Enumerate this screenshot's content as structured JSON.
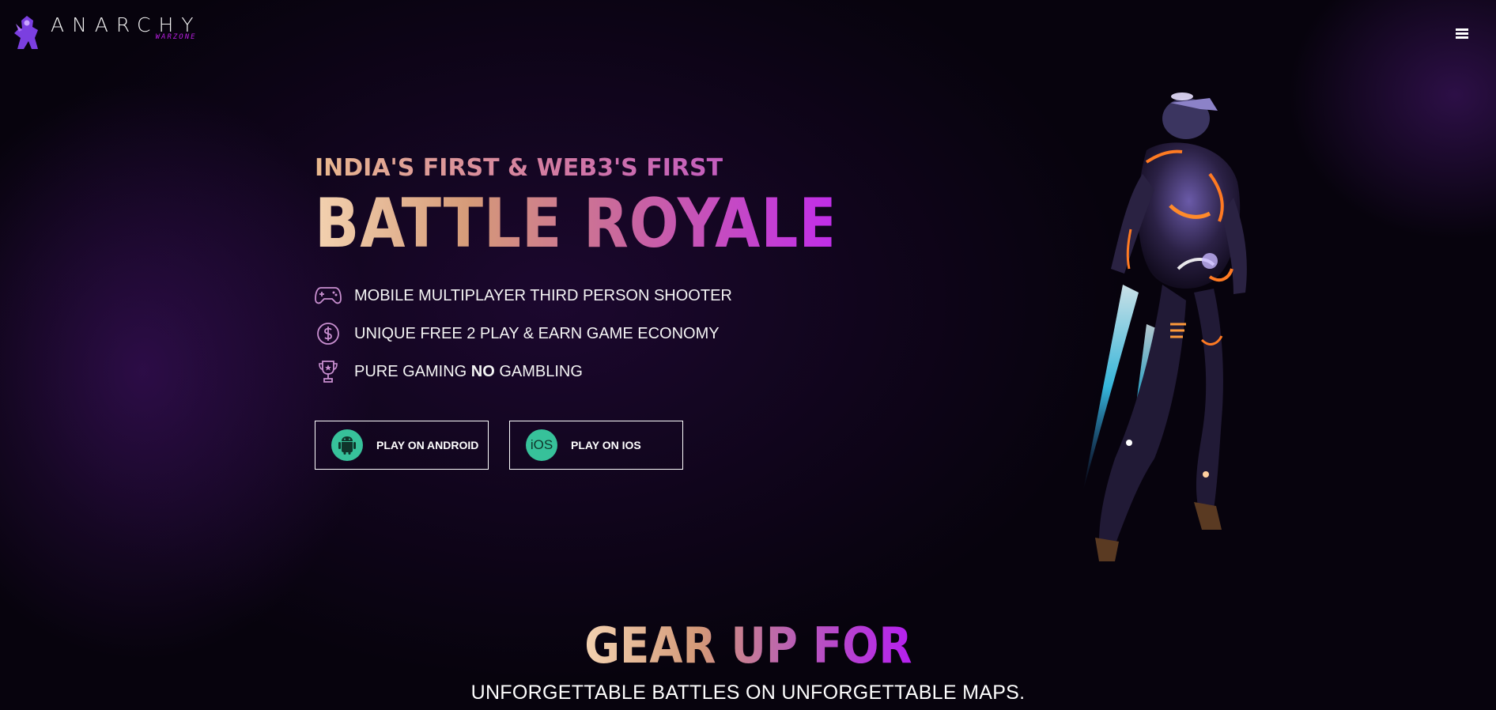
{
  "header": {
    "logo": {
      "word": "ANARCHY",
      "sub": "WARZONE"
    },
    "menu_icon": "hamburger-menu-icon"
  },
  "hero": {
    "eyebrow": "INDIA'S FIRST & WEB3'S FIRST",
    "title": "BATTLE ROYALE",
    "features": [
      {
        "icon": "gamepad-icon",
        "text": "MOBILE MULTIPLAYER THIRD PERSON SHOOTER"
      },
      {
        "icon": "dollar-coin-icon",
        "text": "UNIQUE FREE 2 PLAY & EARN GAME ECONOMY"
      },
      {
        "icon": "trophy-icon",
        "text_before": "PURE GAMING ",
        "text_bold": "NO",
        "text_after": " GAMBLING"
      }
    ],
    "buttons": [
      {
        "icon": "android-icon",
        "label": "PLAY ON ANDROID"
      },
      {
        "icon": "ios-icon",
        "icon_text": "iOS",
        "label": "PLAY ON IOS"
      }
    ]
  },
  "section": {
    "title": "GEAR UP FOR",
    "subtitle": "UNFORGETTABLE BATTLES ON UNFORGETTABLE MAPS."
  },
  "colors": {
    "background": "#07030d",
    "accent_purple": "#b51ff0",
    "accent_peach": "#f3d2b0",
    "store_icon_green": "#37c19a"
  }
}
